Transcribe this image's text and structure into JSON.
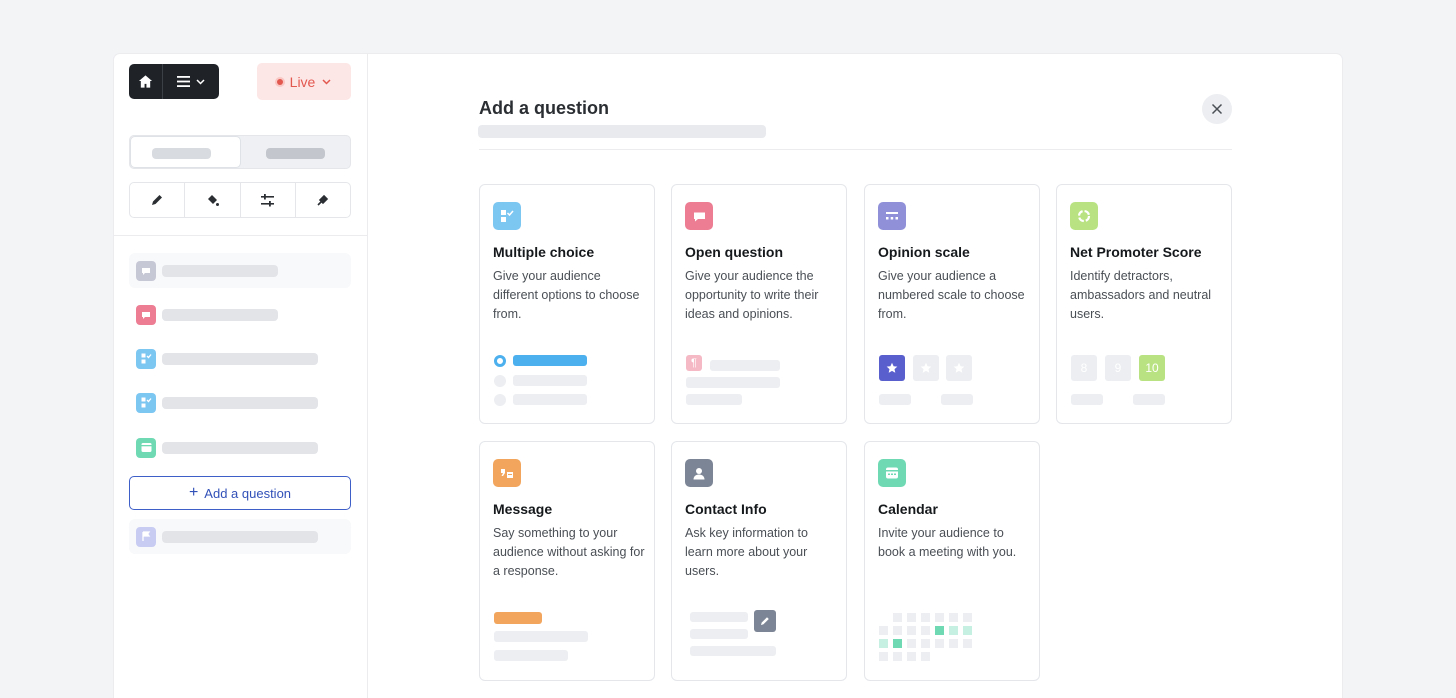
{
  "sidebar": {
    "live_label": "Live",
    "add_question_label": "Add a question"
  },
  "dialog": {
    "title": "Add a question"
  },
  "cards": [
    {
      "title": "Multiple choice",
      "description": "Give your audience different options to choose from.",
      "icon": "checklist-icon",
      "color": "#7cc6f2"
    },
    {
      "title": "Open question",
      "description": "Give your audience the opportunity to write their ideas and opinions.",
      "icon": "chat-bubble-icon",
      "color": "#ec7d93"
    },
    {
      "title": "Opinion scale",
      "description": "Give your audience a numbered scale to choose from.",
      "icon": "scale-icon",
      "color": "#8f90d8"
    },
    {
      "title": "Net Promoter Score",
      "description": "Identify detractors, ambassadors and neutral users.",
      "icon": "gauge-icon",
      "color": "#b9e382"
    },
    {
      "title": "Message",
      "description": "Say something to your audience without asking for a response.",
      "icon": "quote-icon",
      "color": "#f2a65d"
    },
    {
      "title": "Contact Info",
      "description": "Ask key information to learn more about your users.",
      "icon": "person-icon",
      "color": "#7c8595"
    },
    {
      "title": "Calendar",
      "description": "Invite your audience to book a meeting with you.",
      "icon": "calendar-icon",
      "color": "#6fd9b4"
    }
  ],
  "previews": {
    "nps_numbers": [
      "8",
      "9",
      "10"
    ],
    "paragraph_glyph": "¶"
  },
  "colors": {
    "accent_blue": "#3251b8",
    "live_red": "#e2584f",
    "rating_star": "#5a5fce",
    "nps_selected": "#b9e382"
  }
}
